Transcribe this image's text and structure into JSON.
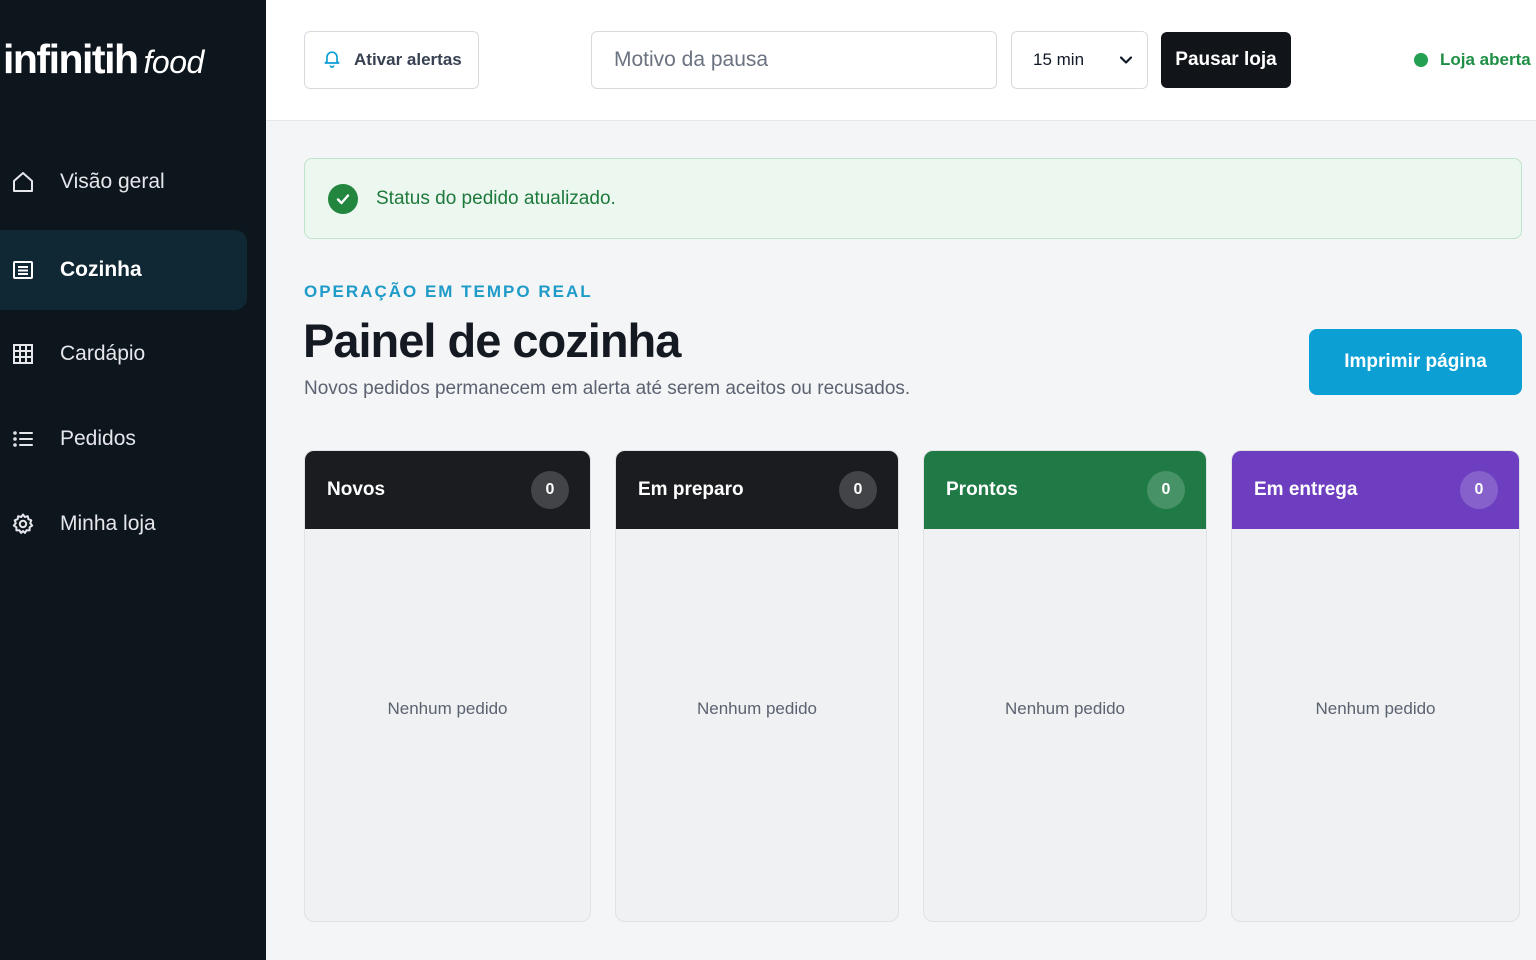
{
  "brand": {
    "name_main": "infinitih",
    "name_sub": "food"
  },
  "sidebar": {
    "items": [
      {
        "label": "Visão geral",
        "icon": "home-icon",
        "active": false
      },
      {
        "label": "Cozinha",
        "icon": "kitchen-list-icon",
        "active": true
      },
      {
        "label": "Cardápio",
        "icon": "grid-icon",
        "active": false
      },
      {
        "label": "Pedidos",
        "icon": "list-icon",
        "active": false
      },
      {
        "label": "Minha loja",
        "icon": "gear-icon",
        "active": false
      }
    ]
  },
  "header": {
    "alert_button": "Ativar alertas",
    "pause_reason_placeholder": "Motivo da pausa",
    "pause_reason_value": "",
    "duration_selected": "15 min",
    "pause_button": "Pausar loja",
    "store_status": "Loja aberta"
  },
  "toast": {
    "message": "Status do pedido atualizado.",
    "type": "success"
  },
  "main": {
    "eyebrow": "OPERAÇÃO EM TEMPO REAL",
    "title": "Painel de cozinha",
    "subtitle": "Novos pedidos permanecem em alerta até serem aceitos ou recusados.",
    "print_button": "Imprimir página"
  },
  "columns": [
    {
      "title": "Novos",
      "count": "0",
      "empty_text": "Nenhum pedido",
      "color": "#1a1c20"
    },
    {
      "title": "Em preparo",
      "count": "0",
      "empty_text": "Nenhum pedido",
      "color": "#1a1c20"
    },
    {
      "title": "Prontos",
      "count": "0",
      "empty_text": "Nenhum pedido",
      "color": "#1f7a45"
    },
    {
      "title": "Em entrega",
      "count": "0",
      "empty_text": "Nenhum pedido",
      "color": "#6d3fc0"
    }
  ],
  "colors": {
    "sidebar_bg": "#0d151d",
    "accent": "#0b9fd3",
    "success": "#22863f",
    "status_open": "#23a052"
  }
}
